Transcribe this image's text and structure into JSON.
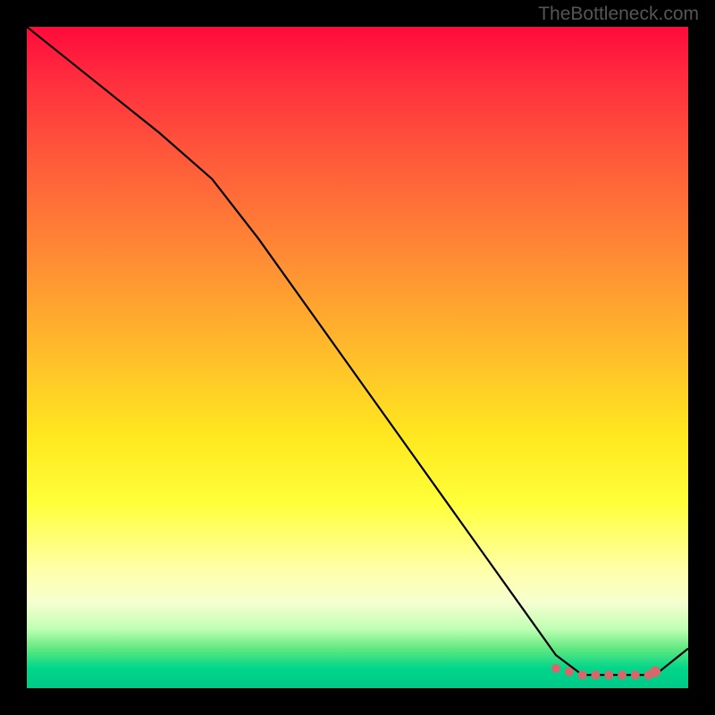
{
  "watermark": "TheBottleneck.com",
  "chart_data": {
    "type": "line",
    "title": "",
    "xlabel": "",
    "ylabel": "",
    "xlim": [
      0,
      100
    ],
    "ylim": [
      0,
      100
    ],
    "series": [
      {
        "name": "bottleneck-curve",
        "x": [
          0,
          10,
          20,
          28,
          35,
          45,
          55,
          65,
          75,
          80,
          84,
          88,
          92,
          95,
          100
        ],
        "y": [
          100,
          92,
          84,
          77,
          68,
          54,
          40,
          26,
          12,
          5,
          2,
          2,
          2,
          2,
          6
        ]
      }
    ],
    "highlight_points": {
      "name": "optimal-range",
      "x": [
        80,
        82,
        84,
        86,
        88,
        90,
        92,
        94,
        95
      ],
      "y": [
        3,
        2.5,
        2,
        2,
        2,
        2,
        2,
        2,
        2.5
      ]
    },
    "gradient_stops": [
      {
        "offset": 0.0,
        "color": "#ff0a3c"
      },
      {
        "offset": 0.35,
        "color": "#ff8c34"
      },
      {
        "offset": 0.62,
        "color": "#ffe81f"
      },
      {
        "offset": 0.85,
        "color": "#ffffc0"
      },
      {
        "offset": 1.0,
        "color": "#00c888"
      }
    ]
  }
}
